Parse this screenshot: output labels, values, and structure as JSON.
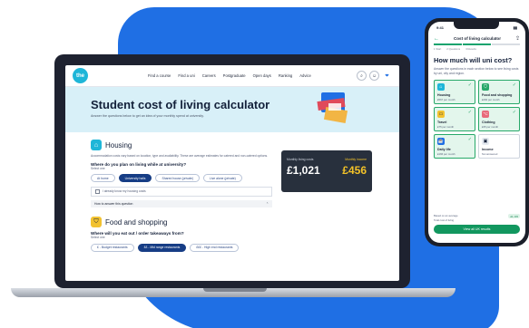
{
  "site": {
    "logo_text": "the",
    "nav": [
      "Find a course",
      "Find a uni",
      "Careers",
      "Postgraduate",
      "Open days",
      "Ranking",
      "Advice"
    ]
  },
  "hero": {
    "title": "Student cost of living calculator",
    "subtitle": "Answer the questions below to get an idea of your monthly spend at university."
  },
  "housing": {
    "title": "Housing",
    "description": "Accommodation costs vary based on location, type and availability. These are average estimates for catered and non-catered options.",
    "question": "Where do you plan on living while at university?",
    "hint": "Select one",
    "options": [
      "At home",
      "University halls",
      "Shared house (private)",
      "Live alone (private)"
    ],
    "selected_option": "University halls",
    "checkbox_label": "I already know my housing costs",
    "accordion": "How to answer this question",
    "accordion_icon": "chevron-up"
  },
  "food": {
    "title": "Food and shopping",
    "question": "Where will you eat out / order takeaways from?",
    "hint": "Select one",
    "options": [
      "£ - Budget restaurants",
      "££ - Mid range restaurants",
      "£££ - High end restaurants"
    ],
    "selected_option": "££ - Mid range restaurants"
  },
  "cost_card": {
    "left_label": "Monthly living costs",
    "left_value": "£1,021",
    "right_label": "Monthly income",
    "right_value": "£456"
  },
  "phone": {
    "time": "9:41",
    "header_title": "Cost of living calculator",
    "steps": [
      "1 Start",
      "2 Questions",
      "3 Results"
    ],
    "question": "How much will uni cost?",
    "description": "Answer the questions in each section below to see living costs by uni, city and region.",
    "tiles": [
      {
        "name": "Housing",
        "value": "£567 per month",
        "icon": "house-icon",
        "done": true
      },
      {
        "name": "Food and shopping",
        "value": "£260 per month",
        "icon": "basket-icon",
        "done": true
      },
      {
        "name": "Travel",
        "value": "£75 per month",
        "icon": "bus-icon",
        "done": true
      },
      {
        "name": "Clothing",
        "value": "£35 per month",
        "icon": "shirt-icon",
        "done": true
      },
      {
        "name": "Daily life",
        "value": "£166 per month",
        "icon": "coffee-icon",
        "done": true
      },
      {
        "name": "Income",
        "value": "Not answered",
        "icon": "wallet-icon",
        "done": false
      }
    ],
    "footer_label": "Based on an average",
    "footer_value": "Total cost of living",
    "footer_tag": "£1,103",
    "button": "View all UK results"
  }
}
